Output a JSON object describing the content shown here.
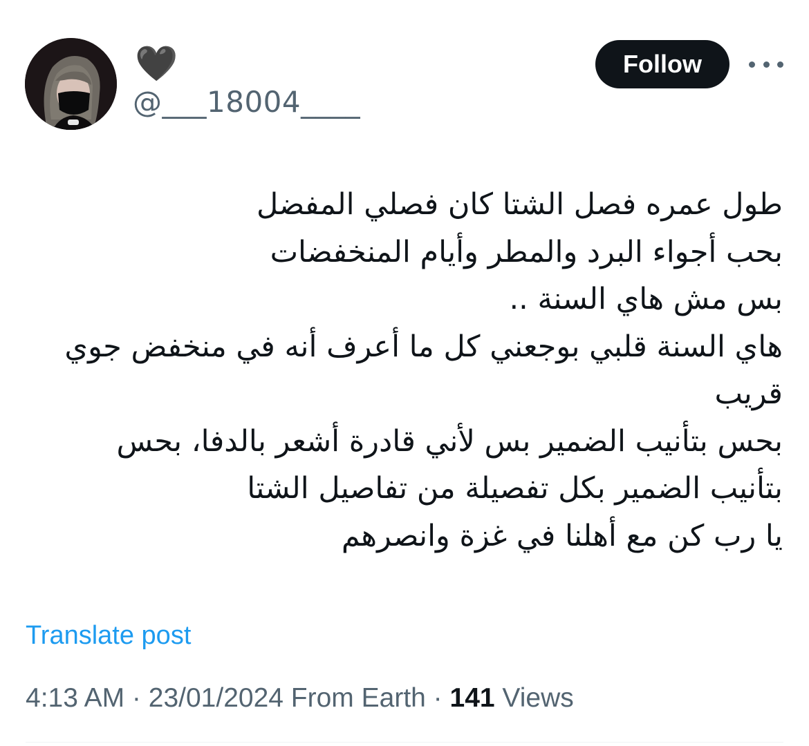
{
  "user": {
    "display_name": "🖤",
    "handle": "@___18004____"
  },
  "actions": {
    "follow_label": "Follow",
    "more_icon": "more-horizontal-icon"
  },
  "tweet": {
    "lines": [
      "طول عمره فصل الشتا كان فصلي المفضل",
      "بحب أجواء البرد والمطر وأيام المنخفضات",
      "بس مش هاي السنة ..",
      "هاي السنة قلبي بوجعني كل ما أعرف أنه في منخفض جوي",
      "قريب",
      "بحس بتأنيب الضمير بس لأني قادرة أشعر بالدفا، بحس",
      "بتأنيب الضمير بكل تفصيلة من تفاصيل الشتا",
      "يا رب كن مع أهلنا في غزة وانصرهم"
    ]
  },
  "translate": {
    "label": "Translate post"
  },
  "meta": {
    "time": "4:13 AM",
    "separator": " · ",
    "date": "23/01/2024",
    "source": " From Earth",
    "views_count": "141",
    "views_label": " Views"
  },
  "colors": {
    "text": "#0f1419",
    "secondary": "#536471",
    "link": "#1d9bf0",
    "button_bg": "#0f1419",
    "button_text": "#ffffff"
  }
}
